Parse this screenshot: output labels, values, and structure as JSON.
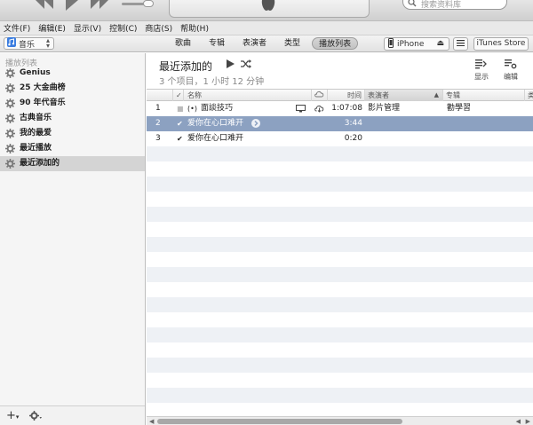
{
  "search": {
    "placeholder": "搜索资料库"
  },
  "menu": [
    "文件(F)",
    "编辑(E)",
    "显示(V)",
    "控制(C)",
    "商店(S)",
    "帮助(H)"
  ],
  "nav": {
    "library_label": "音乐",
    "tabs": [
      "歌曲",
      "专辑",
      "表演者",
      "类型",
      "播放列表"
    ],
    "active_tab": 4,
    "device_label": "iPhone",
    "store_label": "iTunes Store"
  },
  "sidebar": {
    "section_label": "播放列表",
    "items": [
      "Genius",
      "25 大金曲榜",
      "90 年代音乐",
      "古典音乐",
      "我的最爱",
      "最近播放",
      "最近添加的"
    ],
    "selected_index": 6
  },
  "playlist": {
    "title": "最近添加的",
    "summary": "3 个项目，1 小时 12 分钟",
    "show_label": "显示",
    "edit_label": "编辑"
  },
  "columns": {
    "check": "✓",
    "name": "名称",
    "time": "时间",
    "artist": "表演者",
    "album": "专辑",
    "genre_partial": "类"
  },
  "tracks": [
    {
      "num": "1",
      "name": "面談技巧",
      "time": "1:07:08",
      "artist": "影片管理",
      "album": "勸學習",
      "checked": false,
      "selected": false,
      "podcast": true
    },
    {
      "num": "2",
      "name": "爱你在心口难开",
      "time": "3:44",
      "artist": "",
      "album": "",
      "checked": true,
      "selected": true,
      "podcast": false
    },
    {
      "num": "3",
      "name": "爱你在心口难开",
      "time": "0:20",
      "artist": "",
      "album": "",
      "checked": true,
      "selected": false,
      "podcast": false
    }
  ],
  "colors": {
    "selection": "#8ca1c1",
    "alt_row": "#eef1f5",
    "sidebar_selected": "#d4d4d4"
  }
}
